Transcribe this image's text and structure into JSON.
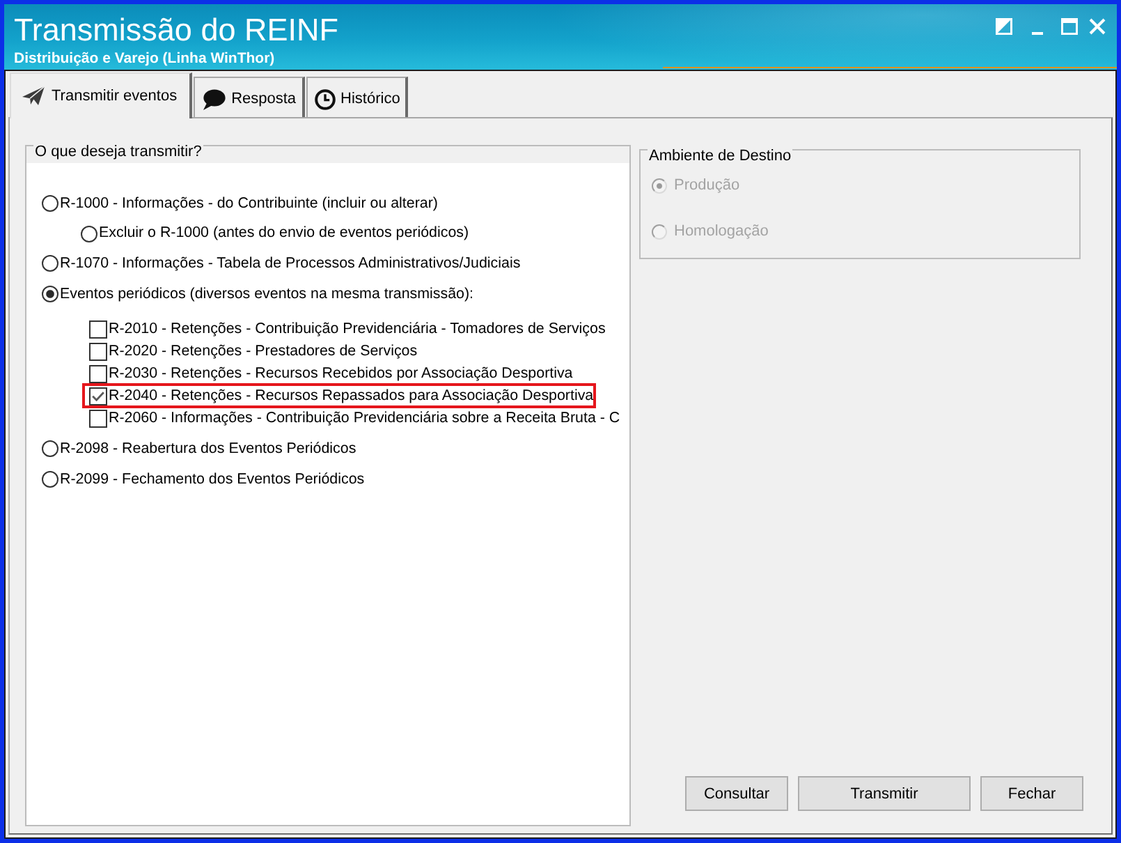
{
  "window": {
    "title": "Transmissão do REINF",
    "subtitle": "Distribuição e Varejo (Linha WinThor)"
  },
  "tabs": [
    {
      "label": "Transmitir eventos",
      "selected": true
    },
    {
      "label": "Resposta",
      "selected": false
    },
    {
      "label": "Histórico",
      "selected": false
    }
  ],
  "transmit_group": {
    "title": "O que deseja transmitir?",
    "options": [
      {
        "kind": "radio",
        "label": "R-1000 - Informações - do Contribuinte (incluir ou alterar)",
        "selected": false,
        "children": [
          {
            "kind": "radio",
            "label": "Excluir o R-1000 (antes do envio de eventos periódicos)",
            "selected": false
          }
        ]
      },
      {
        "kind": "radio",
        "label": "R-1070 - Informações - Tabela de Processos Administrativos/Judiciais",
        "selected": false
      },
      {
        "kind": "radio",
        "label": "Eventos periódicos (diversos eventos na mesma transmissão):",
        "selected": true,
        "children": [
          {
            "kind": "checkbox",
            "label": "R-2010 - Retenções - Contribuição Previdenciária - Tomadores de Serviços",
            "checked": false,
            "highlighted": false
          },
          {
            "kind": "checkbox",
            "label": "R-2020 - Retenções - Prestadores de Serviços",
            "checked": false,
            "highlighted": false
          },
          {
            "kind": "checkbox",
            "label": "R-2030 - Retenções - Recursos Recebidos por Associação Desportiva",
            "checked": false,
            "highlighted": false
          },
          {
            "kind": "checkbox",
            "label": "R-2040 - Retenções - Recursos Repassados para Associação Desportiva",
            "checked": true,
            "highlighted": true
          },
          {
            "kind": "checkbox",
            "label": "R-2060 - Informações - Contribuição Previdenciária sobre a Receita Bruta - C",
            "checked": false,
            "highlighted": false
          }
        ]
      },
      {
        "kind": "radio",
        "label": "R-2098 - Reabertura dos Eventos Periódicos",
        "selected": false
      },
      {
        "kind": "radio",
        "label": "R-2099 - Fechamento dos Eventos Periódicos",
        "selected": false
      }
    ]
  },
  "destination_group": {
    "title": "Ambiente de Destino",
    "options": [
      {
        "kind": "radio",
        "label": "Produção",
        "selected": true,
        "disabled": true
      },
      {
        "kind": "radio",
        "label": "Homologação",
        "selected": false,
        "disabled": true
      }
    ]
  },
  "buttons": [
    "Consultar",
    "Transmitir",
    "Fechar"
  ]
}
